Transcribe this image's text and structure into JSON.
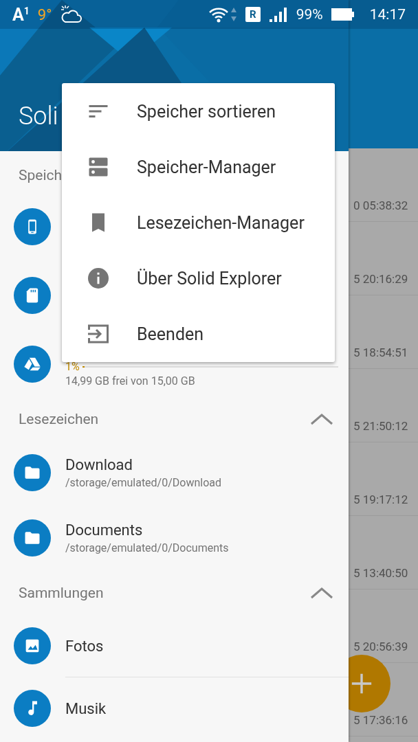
{
  "status_bar": {
    "carrier": "A$^{1}$",
    "temperature": "9°",
    "roaming": "R",
    "battery": "99%",
    "time": "14:17"
  },
  "background_list": {
    "timestamps": [
      "0 05:38:32",
      "5 20:16:29",
      "5 18:54:51",
      "5 21:50:12",
      "5 19:17:12",
      "5 13:40:50",
      "5 20:56:39",
      "5 17:36:16"
    ]
  },
  "drawer": {
    "title": "Soli",
    "storage": {
      "header": "Speich",
      "items": [
        {
          "kind": "phone"
        },
        {
          "kind": "sd-card"
        },
        {
          "kind": "drive",
          "percent": "1%",
          "level": 0.01,
          "free": "14,99 GB frei von 15,00 GB"
        }
      ]
    },
    "bookmarks": {
      "header": "Lesezeichen",
      "expanded": true,
      "items": [
        {
          "name": "Download",
          "path": "/storage/emulated/0/Download"
        },
        {
          "name": "Documents",
          "path": "/storage/emulated/0/Documents"
        }
      ]
    },
    "collections": {
      "header": "Sammlungen",
      "expanded": true,
      "items": [
        {
          "name": "Fotos",
          "kind": "photos"
        },
        {
          "name": "Musik",
          "kind": "music"
        }
      ]
    }
  },
  "menu": [
    {
      "label": "Speicher sortieren",
      "kind": "sort"
    },
    {
      "label": "Speicher-Manager",
      "kind": "storage"
    },
    {
      "label": "Lesezeichen-Manager",
      "kind": "bookmark"
    },
    {
      "label": "Über Solid Explorer",
      "kind": "info"
    },
    {
      "label": "Beenden",
      "kind": "exit"
    }
  ]
}
